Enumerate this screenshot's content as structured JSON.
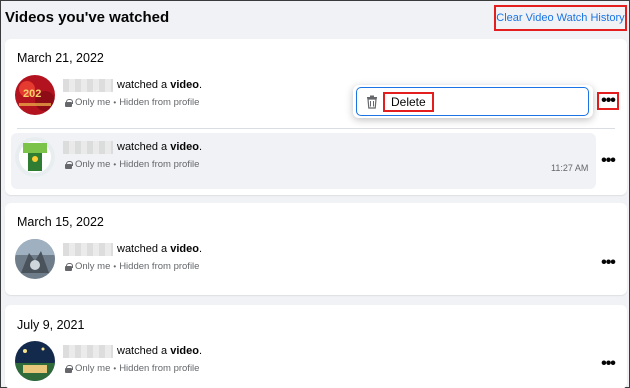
{
  "header": {
    "title": "Videos you've watched",
    "clear_label": "Clear Video Watch History"
  },
  "groups": [
    {
      "date": "March 21, 2022",
      "entries": [
        {
          "action": "watched a ",
          "object": "video",
          "suffix": ".",
          "audience": "Only me",
          "visibility": "Hidden from profile",
          "time": ""
        },
        {
          "action": "watched a ",
          "object": "video",
          "suffix": ".",
          "audience": "Only me",
          "visibility": "Hidden from profile",
          "time": "11:27 AM"
        }
      ]
    },
    {
      "date": "March 15, 2022",
      "entries": [
        {
          "action": "watched a ",
          "object": "video",
          "suffix": ".",
          "audience": "Only me",
          "visibility": "Hidden from profile",
          "time": ""
        }
      ]
    },
    {
      "date": "July 9, 2021",
      "entries": [
        {
          "action": "watched a ",
          "object": "video",
          "suffix": ".",
          "audience": "Only me",
          "visibility": "Hidden from profile",
          "time": ""
        }
      ]
    }
  ],
  "menu": {
    "delete_label": "Delete"
  },
  "colors": {
    "accent": "#1b74e4",
    "highlight": "#e41e1e",
    "background": "#f0f2f5"
  }
}
